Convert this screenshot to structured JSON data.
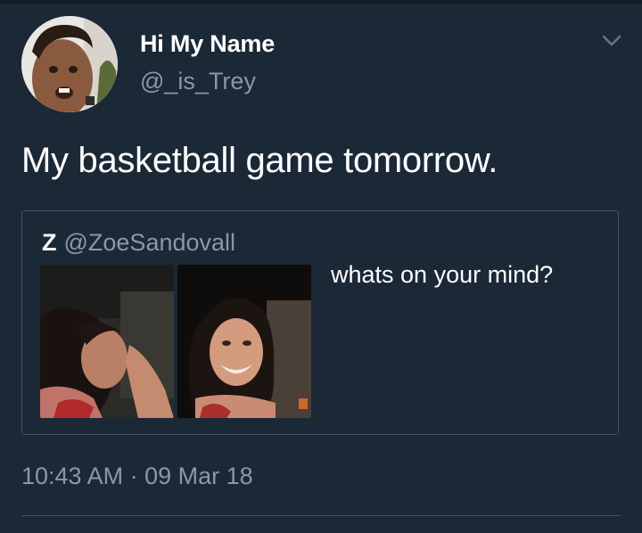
{
  "tweet": {
    "author": {
      "name": "Hi My Name",
      "handle": "@_is_Trey"
    },
    "text": "My basketball game tomorrow.",
    "timestamp": "10:43 AM · 09 Mar 18"
  },
  "quoted_tweet": {
    "name": "Z",
    "handle": "@ZoeSandovall",
    "text": "whats on your mind?",
    "media_count": 2
  },
  "icons": {
    "menu": "chevron-down-icon"
  },
  "colors": {
    "background": "#1b2836",
    "primary_text": "#ffffff",
    "secondary_text": "#8899a6",
    "border": "#3d5466"
  }
}
